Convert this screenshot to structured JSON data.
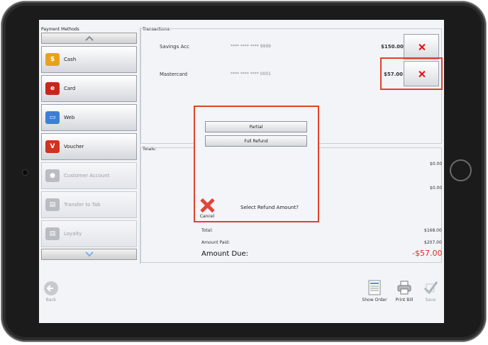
{
  "payment_methods": {
    "header": "Payment Methods",
    "items": [
      {
        "label": "Cash",
        "icon": "cash-icon",
        "enabled": true
      },
      {
        "label": "Card",
        "icon": "card-icon",
        "enabled": true
      },
      {
        "label": "Web",
        "icon": "web-icon",
        "enabled": true
      },
      {
        "label": "Voucher",
        "icon": "voucher-icon",
        "enabled": true
      },
      {
        "label": "Customer Account",
        "icon": "customer-account-icon",
        "enabled": false
      },
      {
        "label": "Transfer to Tab",
        "icon": "transfer-icon",
        "enabled": false
      },
      {
        "label": "Loyalty",
        "icon": "loyalty-icon",
        "enabled": false
      }
    ]
  },
  "transactions": {
    "header": "Transactions:",
    "rows": [
      {
        "name": "Savings Acc",
        "masked": "**** **** **** 9999",
        "amount": "$150.00"
      },
      {
        "name": "Mastercard",
        "masked": "**** **** **** 0001",
        "amount": "$57.00"
      }
    ]
  },
  "totals": {
    "header": "Totals:",
    "line1": "$0.00",
    "line2": "$0.00",
    "total_label": "Total:",
    "total_value": "$168.00",
    "paid_label": "Amount Paid:",
    "paid_value": "$207.00",
    "due_label": "Amount Due:",
    "due_value": "-$57.00"
  },
  "dialog": {
    "partial": "Partial",
    "full_refund": "Full Refund",
    "cancel": "Cancel",
    "prompt": "Select Refund Amount?"
  },
  "toolbar": {
    "back": "Back",
    "show_order": "Show Order",
    "print_bill": "Print Bill",
    "save": "Save"
  },
  "colors": {
    "highlight": "#e0422b",
    "due": "#e0291f"
  }
}
